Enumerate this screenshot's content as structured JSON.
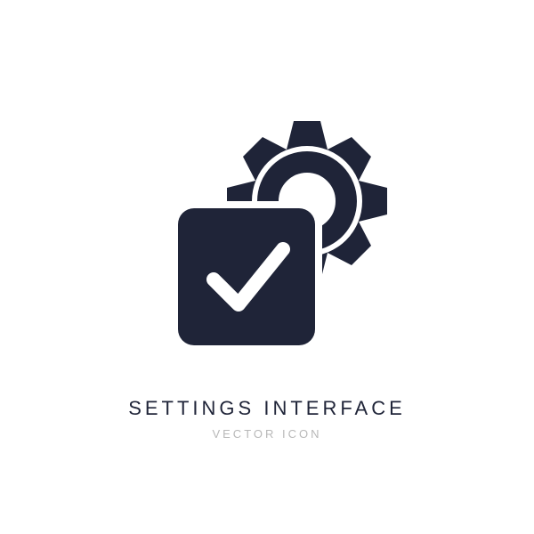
{
  "icon": {
    "name": "settings-interface-icon",
    "color": "#1f2438"
  },
  "title": "SETTINGS INTERFACE",
  "subtitle": "VECTOR ICON"
}
